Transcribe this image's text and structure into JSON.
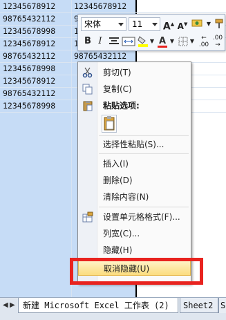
{
  "sheet": {
    "col_a": [
      "12345678912",
      "98765432112",
      "12345678998",
      "12345678912",
      "98765432112",
      "12345678998",
      "12345678912",
      "98765432112",
      "12345678998"
    ],
    "col_b": [
      "12345678912",
      "98765432112",
      "12345678998",
      "12345678912",
      "98765432112"
    ]
  },
  "mini_toolbar": {
    "font_name": "宋体",
    "font_size": "11",
    "grow_font": "A",
    "shrink_font": "A",
    "bold": "B",
    "italic": "I",
    "font_color_glyph": "A",
    "percent": "%",
    "comma": ",",
    "dec_increase": ".00",
    "dec_decrease": ".00",
    "highlight_color": "#ffff00",
    "font_color": "#e8231f"
  },
  "context_menu": {
    "cut": "剪切(T)",
    "copy": "复制(C)",
    "paste_options": "粘贴选项:",
    "paste_special": "选择性粘贴(S)...",
    "insert": "插入(I)",
    "delete": "删除(D)",
    "clear_contents": "清除内容(N)",
    "format_cells": "设置单元格格式(F)...",
    "column_width": "列宽(C)...",
    "hide": "隐藏(H)",
    "unhide": "取消隐藏(U)"
  },
  "tabs": {
    "active": "新建 Microsoft Excel 工作表 (2)",
    "sheet2": "Sheet2",
    "sheet3": "S"
  },
  "colors": {
    "selection": "#c6dcf6",
    "highlight_border": "#e8231f",
    "menu_hover": "#fbdc7e"
  }
}
